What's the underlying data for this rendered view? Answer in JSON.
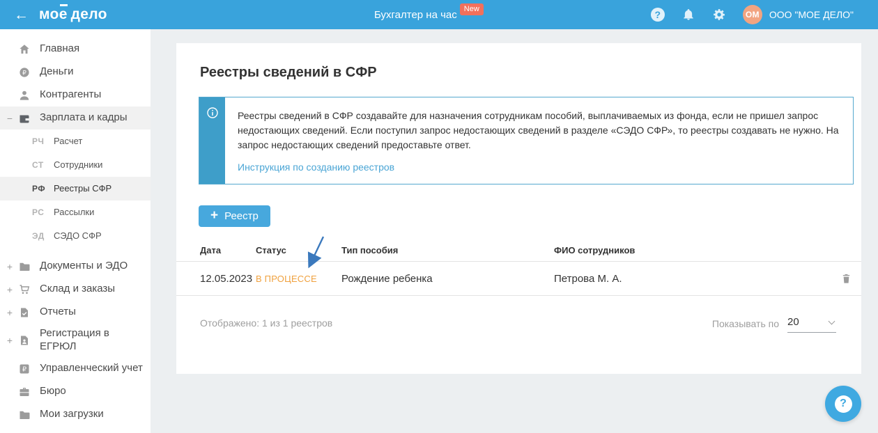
{
  "header": {
    "logo": {
      "prefix": "мо",
      "accent_letter": "е",
      "suffix": "дело"
    },
    "promo_link": "Бухгалтер на час",
    "new_badge": "New",
    "icons": [
      "back-arrow-icon",
      "help-icon",
      "bell-icon",
      "gear-icon"
    ],
    "avatar_initials": "ОМ",
    "company": "ООО \"МОЕ ДЕЛО\""
  },
  "sidebar": {
    "items": [
      {
        "id": "home",
        "type": "top",
        "label": "Главная",
        "icon": "home-icon"
      },
      {
        "id": "money",
        "type": "top",
        "label": "Деньги",
        "icon": "money-icon"
      },
      {
        "id": "contractors",
        "type": "top",
        "label": "Контрагенты",
        "icon": "contractors-icon"
      },
      {
        "id": "salary",
        "type": "top",
        "label": "Зарплата и кадры",
        "icon": "wallet-icon",
        "expand": "−",
        "active": true,
        "open": true
      },
      {
        "id": "calculation",
        "type": "sub",
        "label": "Расчет",
        "code": "РЧ"
      },
      {
        "id": "employees",
        "type": "sub",
        "label": "Сотрудники",
        "code": "СТ"
      },
      {
        "id": "registries-sfr",
        "type": "sub",
        "label": "Реестры СФР",
        "code": "РФ",
        "active": true
      },
      {
        "id": "mailings",
        "type": "sub",
        "label": "Рассылки",
        "code": "РС"
      },
      {
        "id": "sedo-sfr",
        "type": "sub",
        "label": "СЭДО СФР",
        "code": "ЭД"
      },
      {
        "id": "documents-edo",
        "type": "top",
        "label": "Документы и ЭДО",
        "icon": "folder-icon",
        "expand": "+",
        "gap": true
      },
      {
        "id": "warehouse-orders",
        "type": "top",
        "label": "Склад и заказы",
        "icon": "cart-icon",
        "expand": "+"
      },
      {
        "id": "reports",
        "type": "top",
        "label": "Отчеты",
        "icon": "report-icon",
        "expand": "+"
      },
      {
        "id": "egrul-registration",
        "type": "top",
        "label": "Регистрация в ЕГРЮЛ",
        "icon": "document-person-icon",
        "expand": "+",
        "tall": true
      },
      {
        "id": "management-accounting",
        "type": "top",
        "label": "Управленческий учет",
        "icon": "ruble-square-icon"
      },
      {
        "id": "bureau",
        "type": "top",
        "label": "Бюро",
        "icon": "briefcase-icon"
      },
      {
        "id": "my-downloads",
        "type": "top",
        "label": "Мои загрузки",
        "icon": "folder-icon"
      }
    ]
  },
  "main": {
    "title": "Реестры сведений в СФР",
    "info": {
      "icon": "info-circle-icon",
      "text": "Реестры сведений в СФР создавайте для назначения сотрудникам пособий, выплачиваемых из фонда, если не пришел запрос недостающих сведений. Если поступил запрос недостающих сведений в разделе «СЭДО СФР», то реестры создавать не нужно. На запрос недостающих сведений предоставьте ответ.",
      "link": "Инструкция по созданию реестров"
    },
    "add_button_label": "Реестр",
    "table": {
      "columns": [
        "Дата",
        "Статус",
        "Тип пособия",
        "ФИО сотрудников"
      ],
      "rows": [
        {
          "date": "12.05.2023",
          "status": "В ПРОЦЕССЕ",
          "status_color": "#F0A13E",
          "type": "Рождение ребенка",
          "employees": "Петрова М. А.",
          "action_icon": "trash-icon"
        }
      ]
    },
    "footer": {
      "shown_text": "Отображено: 1 из 1 реестров",
      "per_page_label": "Показывать по",
      "per_page_value": "20"
    },
    "annotation": {
      "type": "arrow",
      "points_at": "status В ПРОЦЕССЕ",
      "color": "#3B79BD"
    },
    "help_fab_label": "?"
  },
  "colors": {
    "header_blue": "#39A3DC",
    "info_stripe_blue": "#3E9EC9",
    "info_border_blue": "#54A8CE",
    "button_blue": "#47A8DD",
    "link_blue": "#4AA5D5",
    "status_orange": "#F0A13E",
    "fab_blue": "#3FA9E1",
    "badge_red": "#F2705C",
    "avatar_orange": "#F2A481",
    "sidebar_active_bg": "#F1F1F1",
    "content_bg": "#ECEFF1"
  }
}
